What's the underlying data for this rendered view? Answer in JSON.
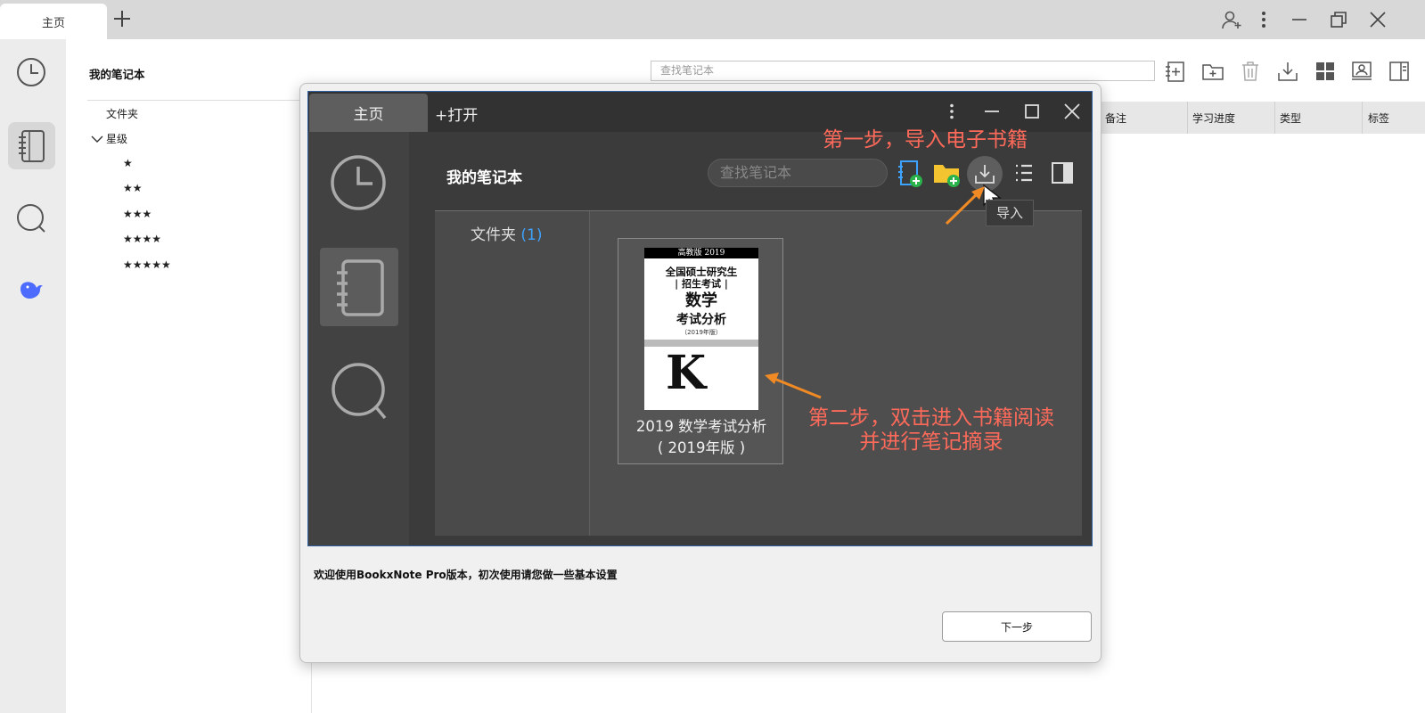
{
  "window": {
    "tab_label": "主页",
    "new_tab_symbol": "+"
  },
  "rail": {
    "items": [
      {
        "icon": "clock-icon",
        "active": false
      },
      {
        "icon": "notebook-icon",
        "active": true
      },
      {
        "icon": "search-icon",
        "active": false
      },
      {
        "icon": "deepseek-whale-icon",
        "active": false
      }
    ]
  },
  "library": {
    "title": "我的笔记本",
    "search_placeholder": "查找笔记本",
    "tree": {
      "folder_label": "文件夹",
      "star_group_label": "星级",
      "stars": [
        "★",
        "★★",
        "★★★",
        "★★★★",
        "★★★★★"
      ]
    },
    "toolbar_icons": [
      "add-notebook-icon",
      "add-folder-icon",
      "trash-icon",
      "import-icon",
      "grid-view-icon",
      "contact-icon",
      "panel-icon"
    ],
    "table_headers": [
      "备注",
      "学习进度",
      "类型",
      "标签"
    ]
  },
  "dialog": {
    "screenshot": {
      "tab_label": "主页",
      "open_label": "+打开",
      "title": "我的笔记本",
      "search_placeholder": "查找笔记本",
      "folder_label": "文件夹",
      "folder_count": "(1)",
      "book": {
        "title_line1": "2019 数学考试分析",
        "title_line2": "( 2019年版 )",
        "cover": {
          "edition": "高教版 2019",
          "line1": "全国硕士研究生",
          "line2": "| 招生考试 |",
          "line3": "数学",
          "line4": "考试分析",
          "line5": "（2019年版）",
          "logo": "K"
        }
      },
      "tooltip": "导入",
      "annotation_step1": "第一步，导入电子书籍",
      "annotation_step2_line1": "第二步，双击进入书籍阅读",
      "annotation_step2_line2": "并进行笔记摘录"
    },
    "welcome_text": "欢迎使用BookxNote Pro版本，初次使用请您做一些基本设置",
    "next_button": "下一步"
  },
  "colors": {
    "accent_blue": "#3ea2ff",
    "annotation_red": "#ff6a5a",
    "arrow_orange": "#f08a24",
    "whale_blue": "#4d6bfe"
  }
}
